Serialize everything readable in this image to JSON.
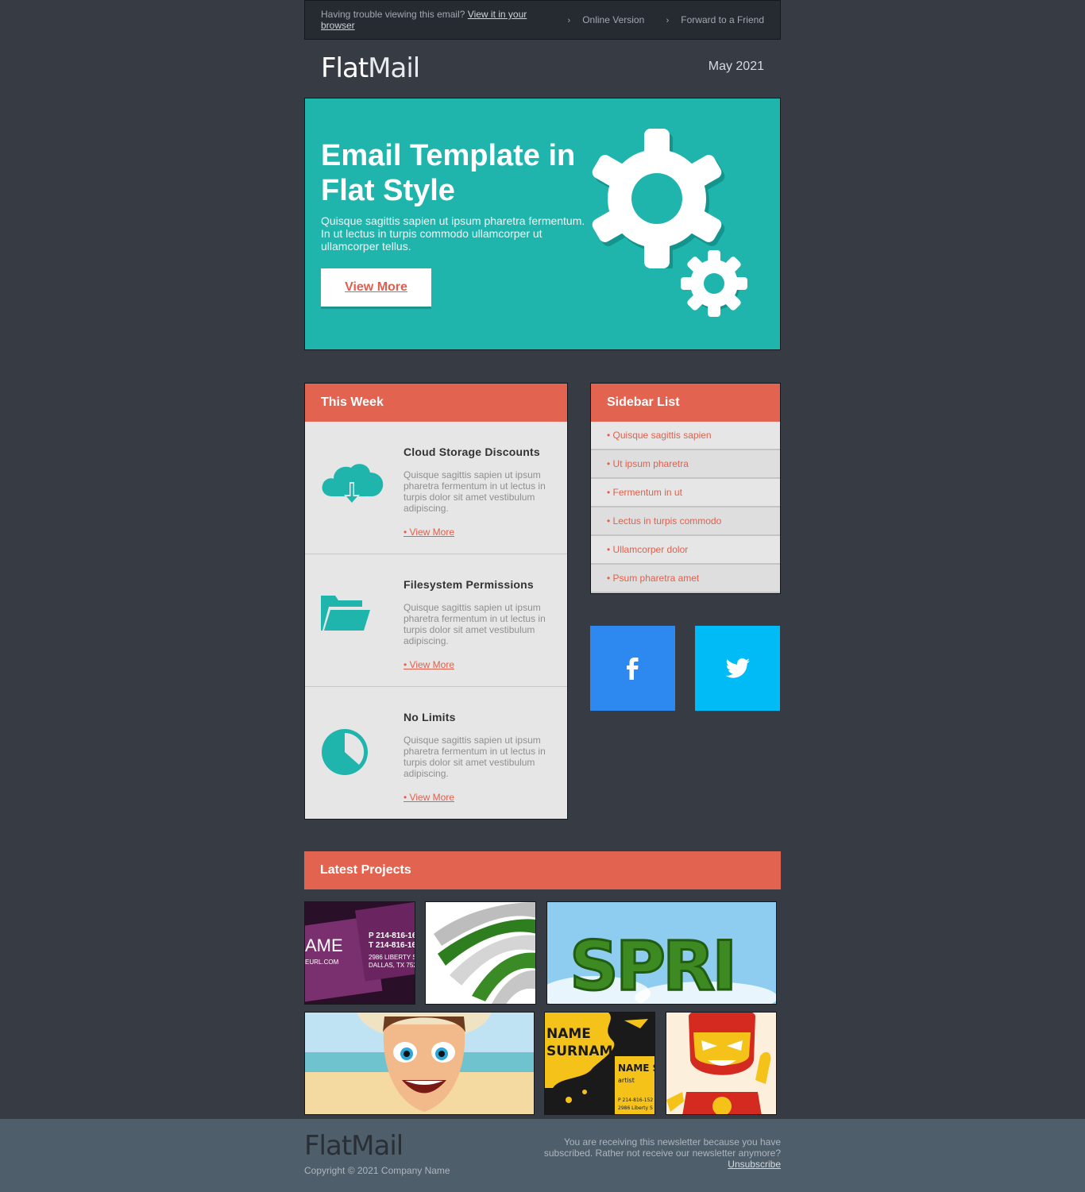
{
  "topbar": {
    "trouble_text": "Having trouble viewing this email?",
    "view_link": "View it in your browser",
    "online_version": "Online Version",
    "forward": "Forward to a Friend"
  },
  "header": {
    "logo_bold": "Flat",
    "logo_light": "Mail",
    "date": "May 2021"
  },
  "hero": {
    "title": "Email Template in Flat Style",
    "text": "Quisque sagittis sapien ut ipsum pharetra fermentum. In ut lectus in turpis commodo ullamcorper ut ullamcorper tellus.",
    "button": "View More",
    "bg_color": "#1fb5ac"
  },
  "this_week": {
    "heading": "This Week",
    "items": [
      {
        "icon": "cloud-download-icon",
        "title": "Cloud Storage Discounts",
        "text": "Quisque sagittis sapien ut ipsum pharetra fermentum in ut lectus in turpis dolor sit amet vestibulum adipiscing.",
        "link": "• View More"
      },
      {
        "icon": "folder-icon",
        "title": "Filesystem Permissions",
        "text": "Quisque sagittis sapien ut ipsum pharetra fermentum in ut lectus in turpis dolor sit amet vestibulum adipiscing.",
        "link": "• View More"
      },
      {
        "icon": "pie-clock-icon",
        "title": "No Limits",
        "text": "Quisque sagittis sapien ut ipsum pharetra fermentum in ut lectus in turpis dolor sit amet vestibulum adipiscing.",
        "link": "• View More"
      }
    ]
  },
  "sidebar": {
    "heading": "Sidebar List",
    "items": [
      "• Quisque sagittis sapien",
      "• Ut ipsum pharetra",
      "• Fermentum in ut",
      "• Lectus in turpis commodo",
      "• Ullamcorper dolor",
      "• Psum pharetra amet"
    ]
  },
  "social": {
    "facebook_color": "#2d89ef",
    "twitter_color": "#00bbf5"
  },
  "latest": {
    "heading": "Latest Projects",
    "thumbnail_subjects": [
      "purple business cards",
      "green and white 3D ribbon logo",
      "grass letters on sky",
      "cartoon man on beach",
      "yellow splash business cards",
      "cartoon superhero"
    ],
    "card1_text": [
      "AME",
      "EURL.COM",
      "P 214-816-16",
      "T 214-816-16",
      "2986 LIBERTY S",
      "DALLAS, TX 752"
    ],
    "spring_text": "SPRI",
    "card2_text": [
      "NAME",
      "SURNAM",
      "NAME S",
      "artist",
      "P 214-816-152",
      "2986 Liberty S"
    ]
  },
  "footer": {
    "logo_bold": "Flat",
    "logo_light": "Mail",
    "copyright": "Copyright © 2021 Company Name",
    "notice": "You are receiving this newsletter because you have subscribed. Rather not receive our newsletter anymore?",
    "unsubscribe": "Unsubscribe"
  },
  "colors": {
    "page_bg": "#363b44",
    "accent_red": "#e16350",
    "teal": "#1fb5ac",
    "panel_bg": "#e6e6e6"
  }
}
